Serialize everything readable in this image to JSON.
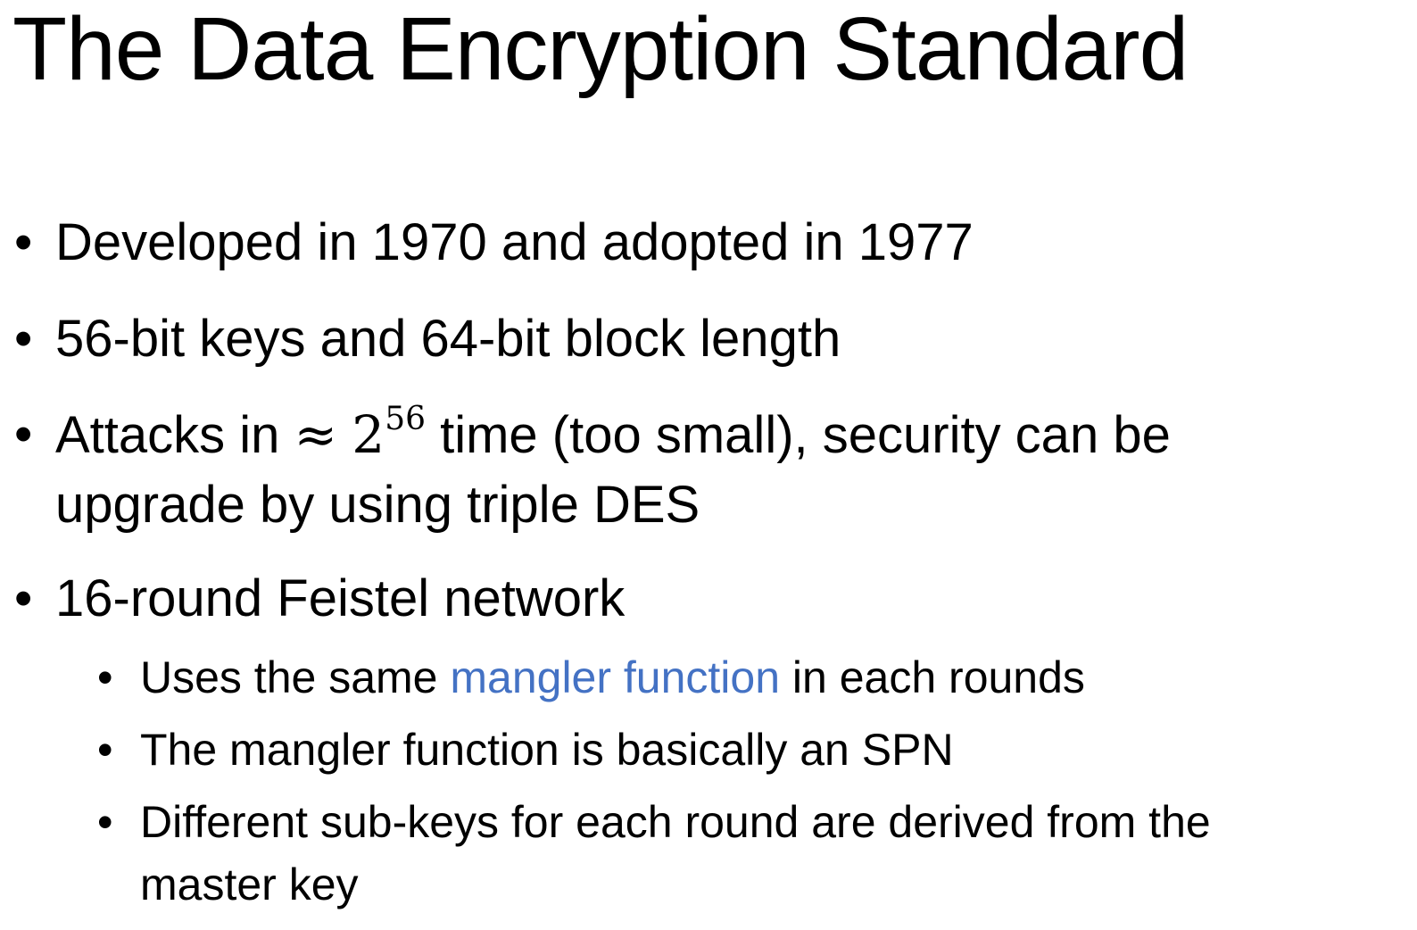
{
  "title": "The Data Encryption Standard",
  "bullet_glyph": "•",
  "colors": {
    "accent": "#4472c4",
    "text": "#000000",
    "background": "#ffffff"
  },
  "bullets": [
    {
      "text": "Developed in 1970 and adopted in 1977"
    },
    {
      "text": "56-bit keys and 64-bit block length"
    },
    {
      "prefix": "Attacks in ",
      "approx": "≈",
      "base": "2",
      "exponent": "56",
      "suffix": " time (too small), security can be",
      "line2": "upgrade by using triple DES"
    },
    {
      "text": "16-round Feistel network",
      "subbullets": [
        {
          "prefix": "Uses the same ",
          "highlight": "mangler function",
          "suffix": " in each rounds"
        },
        {
          "text": "The mangler function is basically an SPN"
        },
        {
          "line1": "Different sub-keys for each round are derived from the",
          "line2": "master key"
        }
      ]
    }
  ]
}
